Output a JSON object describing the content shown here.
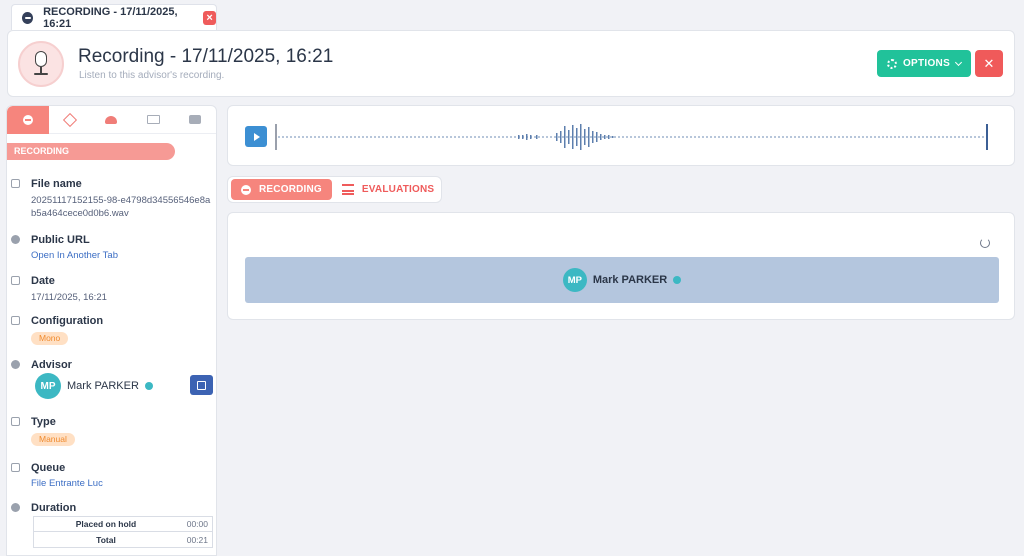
{
  "tab": {
    "label": "RECORDING - 17/11/2025, 16:21"
  },
  "header": {
    "title": "Recording - 17/11/2025, 16:21",
    "subtitle": "Listen to this advisor's recording.",
    "options_label": "OPTIONS",
    "close_label": "✕"
  },
  "sidebar": {
    "section_label": "RECORDING",
    "file_name": {
      "label": "File name",
      "value": "20251117152155-98-e4798d34556546e8ab5a464cece0d0b6.wav"
    },
    "public_url": {
      "label": "Public URL",
      "link": "Open In Another Tab"
    },
    "date": {
      "label": "Date",
      "value": "17/11/2025, 16:21"
    },
    "configuration": {
      "label": "Configuration",
      "badge": "Mono"
    },
    "advisor": {
      "label": "Advisor",
      "initials": "MP",
      "name": "Mark PARKER"
    },
    "type": {
      "label": "Type",
      "badge": "Manual"
    },
    "queue": {
      "label": "Queue",
      "value": "File Entrante Luc"
    },
    "duration": {
      "label": "Duration",
      "rows": [
        {
          "label": "Placed on hold",
          "value": "00:00"
        },
        {
          "label": "Total",
          "value": "00:21"
        }
      ]
    }
  },
  "content_tabs": [
    {
      "label": "RECORDING"
    },
    {
      "label": "EVALUATIONS"
    }
  ],
  "speaker": {
    "initials": "MP",
    "name": "Mark PARKER"
  },
  "colors": {
    "accent": "#f6857d",
    "primary_blue": "#3c63b3",
    "success": "#21c29a",
    "danger": "#f05a5a",
    "speaker_band": "#b4c6de"
  }
}
